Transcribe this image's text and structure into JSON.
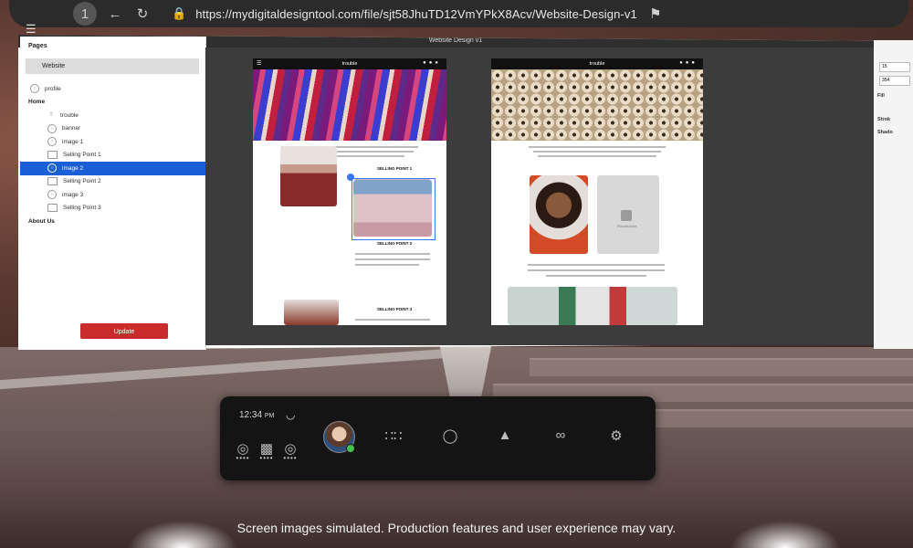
{
  "browser": {
    "url": "https://mydigitaldesigntool.com/file/sjt58JhuTD12VmYPkX8Acv/Website-Design-v1",
    "nav_icons": [
      "tab-count-icon",
      "back-icon",
      "reload-icon",
      "lock-icon",
      "bookmark-icon"
    ]
  },
  "app": {
    "title": "Website Design v1"
  },
  "sidebar": {
    "pages_heading": "Pages",
    "website_item": "Website",
    "layers": [
      {
        "label": "profile",
        "kind": "image"
      },
      {
        "label": "Home",
        "kind": "heading"
      },
      {
        "label": "trouble",
        "kind": "text"
      },
      {
        "label": "banner",
        "kind": "image"
      },
      {
        "label": "image 1",
        "kind": "image"
      },
      {
        "label": "Selling Point 1",
        "kind": "folder"
      },
      {
        "label": "image 2",
        "kind": "image",
        "selected": true
      },
      {
        "label": "Selling Point 2",
        "kind": "folder"
      },
      {
        "label": "image 3",
        "kind": "image"
      },
      {
        "label": "Selling Point 3",
        "kind": "folder"
      },
      {
        "label": "About Us",
        "kind": "heading"
      }
    ],
    "update_label": "Update"
  },
  "canvas": {
    "page_a": {
      "brand": "trouble",
      "selling_point_1": "SELLING POINT 1",
      "selling_point_2": "SELLING POINT 2",
      "selling_point_3": "SELLING POINT 3"
    },
    "page_b": {
      "brand": "trouble",
      "placeholder_label": "Placeholder"
    }
  },
  "right_panel": {
    "value_1": "15",
    "value_2": "354",
    "fill_label": "Fill",
    "stroke_label": "Strok",
    "shadow_label": "Shado"
  },
  "dock": {
    "time": "12:34",
    "ampm": "PM",
    "icons": [
      "wifi-icon",
      "quest-icon",
      "headset-icon",
      "quest-icon-2",
      "apps-grid-icon",
      "messenger-icon",
      "bell-icon",
      "share-icon",
      "gear-icon"
    ]
  },
  "disclaimer": "Screen images simulated. Production features and user experience may vary."
}
